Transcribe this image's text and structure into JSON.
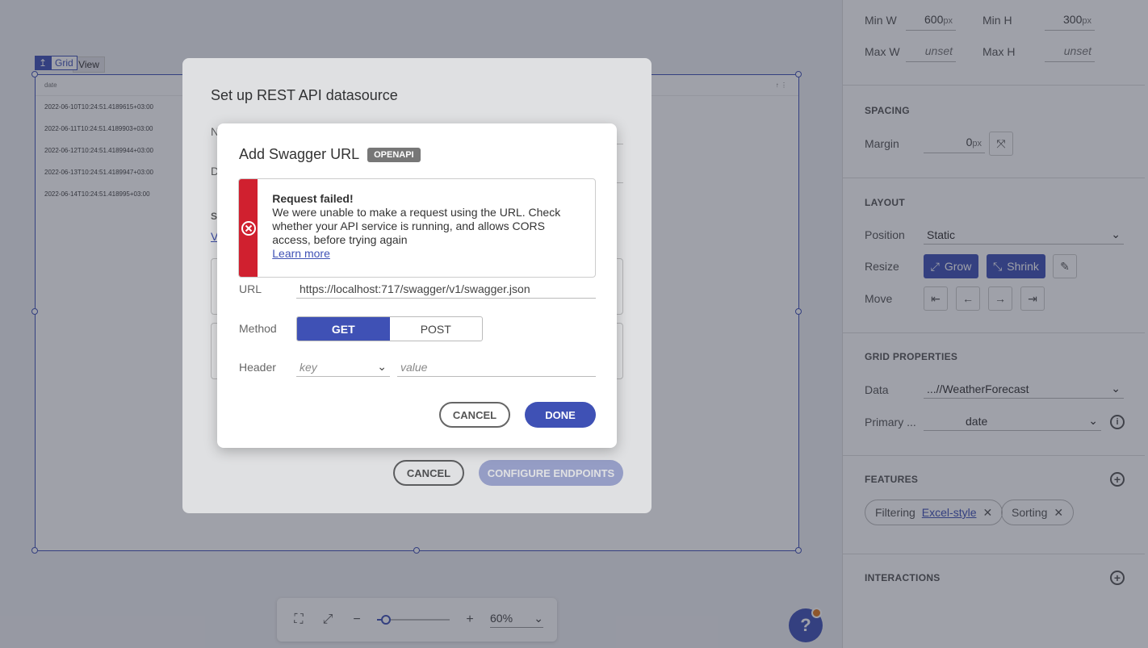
{
  "canvas": {
    "grid_tag_label": "Grid",
    "view_tab_label": "View",
    "grid_header_col": "date",
    "grid_header_icons": "↑ ⋮",
    "rows": [
      "2022-06-10T10:24:51.4189615+03:00",
      "2022-06-11T10:24:51.4189903+03:00",
      "2022-06-12T10:24:51.4189944+03:00",
      "2022-06-13T10:24:51.4189947+03:00",
      "2022-06-14T10:24:51.418995+03:00"
    ]
  },
  "zoom": {
    "value": "60%",
    "level_fraction": 0.12
  },
  "help": {
    "label": "?"
  },
  "panel": {
    "size": {
      "min_w_label": "Min W",
      "min_w_value": "600",
      "min_w_unit": "px",
      "min_h_label": "Min H",
      "min_h_value": "300",
      "min_h_unit": "px",
      "max_w_label": "Max W",
      "max_w_value": "unset",
      "max_h_label": "Max H",
      "max_h_value": "unset"
    },
    "spacing": {
      "title": "SPACING",
      "margin_label": "Margin",
      "margin_value": "0",
      "margin_unit": "px"
    },
    "layout": {
      "title": "LAYOUT",
      "position_label": "Position",
      "position_value": "Static",
      "resize_label": "Resize",
      "grow_label": "Grow",
      "shrink_label": "Shrink",
      "move_label": "Move"
    },
    "grid_props": {
      "title": "GRID PROPERTIES",
      "data_label": "Data",
      "data_value": "...//WeatherForecast",
      "primary_label": "Primary ...",
      "primary_value": "date"
    },
    "features": {
      "title": "FEATURES",
      "filtering_label": "Filtering",
      "filtering_link": "Excel-style",
      "sorting_label": "Sorting"
    },
    "interactions": {
      "title": "INTERACTIONS"
    }
  },
  "back_dialog": {
    "title": "Set up REST API datasource",
    "frag_n": "N",
    "frag_d": "D",
    "frag_s": "S",
    "frag_v": "V",
    "cancel_label": "CANCEL",
    "configure_label": "CONFIGURE ENDPOINTS"
  },
  "dialog": {
    "title": "Add Swagger URL",
    "badge": "OPENAPI",
    "alert": {
      "title": "Request failed!",
      "message": "We were unable to make a request using the URL. Check whether your API service is running, and allows CORS access, before trying again",
      "link": "Learn more"
    },
    "url_label": "URL",
    "url_value": "https://localhost:717/swagger/v1/swagger.json",
    "method_label": "Method",
    "method_get": "GET",
    "method_post": "POST",
    "header_label": "Header",
    "header_key_placeholder": "key",
    "header_value_placeholder": "value",
    "cancel_label": "CANCEL",
    "done_label": "DONE"
  },
  "colors": {
    "accent": "#3f51b5",
    "error": "#d0202f",
    "badge": "#777777"
  }
}
